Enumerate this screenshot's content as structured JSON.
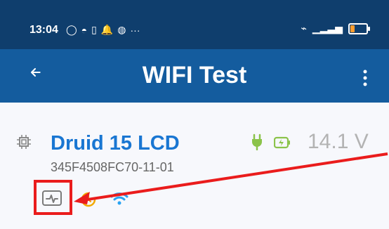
{
  "status_bar": {
    "time": "13:04",
    "more": "···"
  },
  "app_bar": {
    "title": "WIFI Test"
  },
  "device": {
    "name": "Druid 15 LCD",
    "id": "345F4508FC70-11-01",
    "voltage": "14.1 V"
  },
  "colors": {
    "status_bar": "#0f3e6d",
    "app_bar": "#145c9e",
    "device_name": "#1976d2",
    "plug": "#8bc34a",
    "highlight": "#ea1c1c",
    "wifi": "#29a3f2",
    "clock": "#f2a900"
  },
  "icons": {
    "back": "back-arrow-icon",
    "more": "more-vertical-icon",
    "chip": "chip-icon",
    "plug": "plug-icon",
    "battery": "battery-charging-icon",
    "activity": "activity-icon",
    "clock": "clock-icon",
    "wifi": "wifi-icon"
  }
}
